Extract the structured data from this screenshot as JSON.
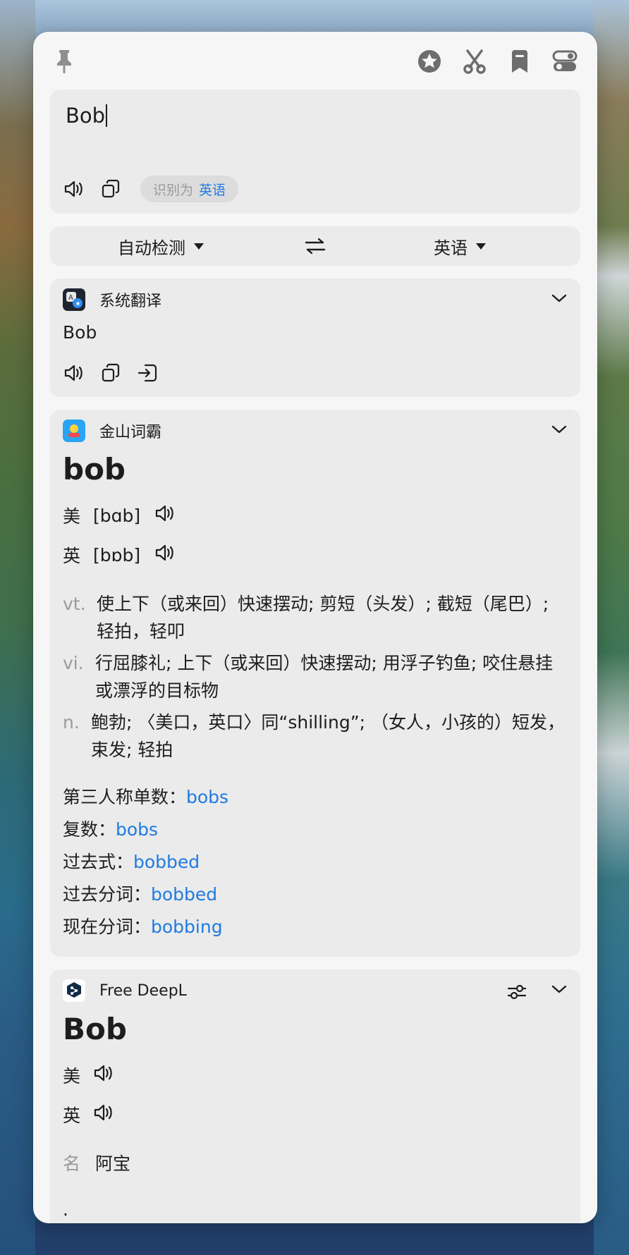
{
  "input": {
    "text": "Bob",
    "detected_label": "识别为",
    "detected_lang": "英语"
  },
  "lang_bar": {
    "source": "自动检测",
    "target": "英语"
  },
  "system_translate": {
    "name": "系统翻译",
    "result": "Bob"
  },
  "iciba": {
    "name": "金山词霸",
    "word": "bob",
    "phonetics": [
      {
        "label": "美",
        "ipa": "[bɑb]"
      },
      {
        "label": "英",
        "ipa": "[bɒb]"
      }
    ],
    "definitions": [
      {
        "pos": "vt.",
        "text": "使上下（或来回）快速摆动; 剪短（头发）; 截短（尾巴）; 轻拍，轻叩"
      },
      {
        "pos": "vi.",
        "text": "行屈膝礼; 上下（或来回）快速摆动; 用浮子钓鱼; 咬住悬挂或漂浮的目标物"
      },
      {
        "pos": "n.",
        "text": "鲍勃; 〈美口，英口〉同“shilling”; （女人，小孩的）短发，束发; 轻拍"
      }
    ],
    "forms": [
      {
        "label": "第三人称单数：",
        "value": "bobs"
      },
      {
        "label": "复数：",
        "value": "bobs"
      },
      {
        "label": "过去式：",
        "value": "bobbed"
      },
      {
        "label": "过去分词：",
        "value": "bobbed"
      },
      {
        "label": "现在分词：",
        "value": "bobbing"
      }
    ]
  },
  "deepl": {
    "name": "Free DeepL",
    "word": "Bob",
    "phonetics": [
      {
        "label": "美"
      },
      {
        "label": "英"
      }
    ],
    "definition": {
      "pos": "名",
      "text": "阿宝"
    },
    "trailing": "."
  },
  "colors": {
    "accent": "#1f7be0",
    "card": "#ebebeb",
    "window": "#f6f6f6"
  }
}
